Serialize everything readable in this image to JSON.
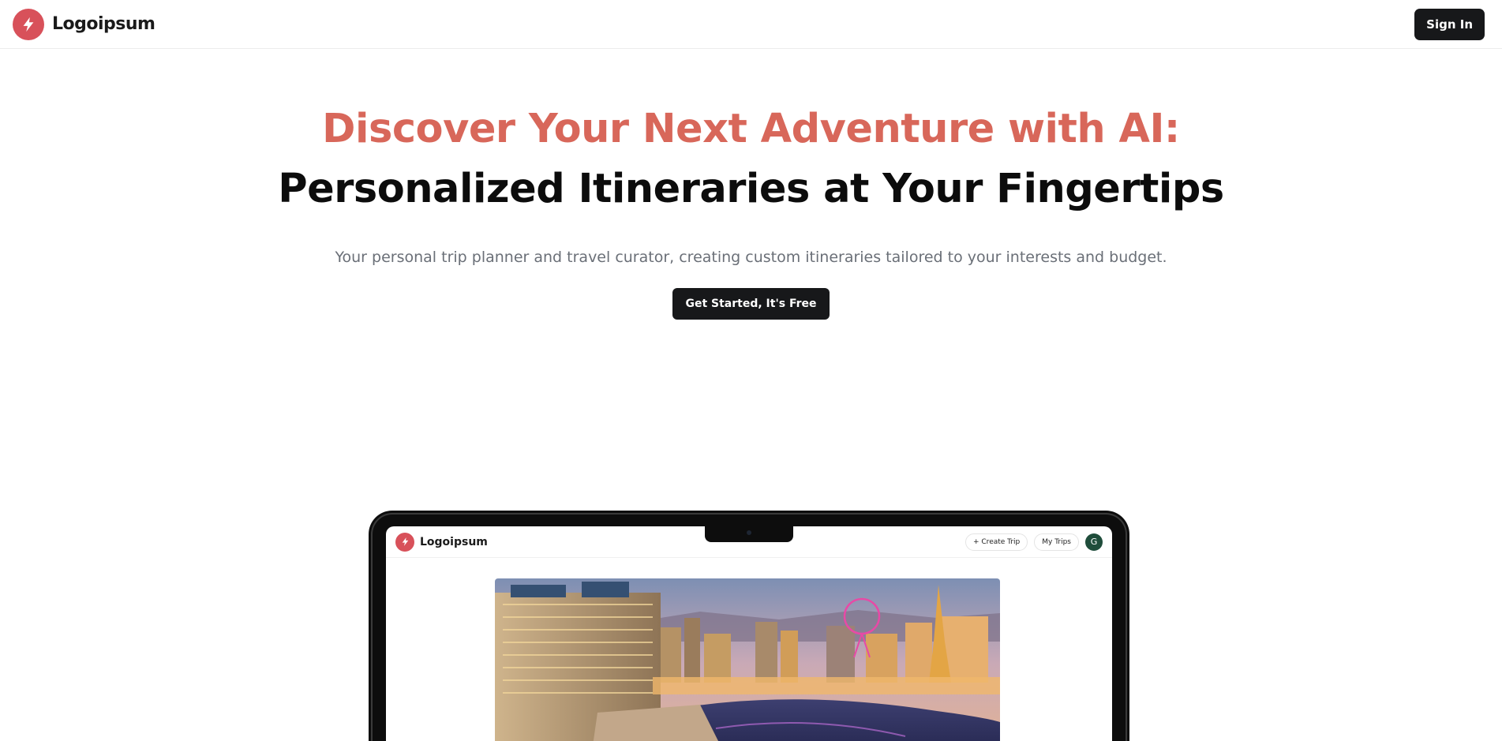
{
  "header": {
    "brand_name": "Logoipsum",
    "logo_icon": "bolt-icon",
    "signin_label": "Sign In"
  },
  "hero": {
    "title_accent": "Discover Your Next Adventure with AI:",
    "title_rest": "Personalized Itineraries at Your Fingertips",
    "subtitle": "Your personal trip planner and travel curator, creating custom itineraries tailored to your interests and budget.",
    "cta_label": "Get Started, It's Free"
  },
  "mockup": {
    "brand_name": "Logoipsum",
    "create_trip_label": "+ Create Trip",
    "my_trips_label": "My Trips",
    "avatar_initial": "G",
    "image_icon": "city-skyline-photo"
  },
  "colors": {
    "accent": "#d8675a",
    "logo": "#d8515a",
    "button": "#17181a",
    "subtitle": "#6a6f77",
    "avatar": "#1f4d3b"
  }
}
